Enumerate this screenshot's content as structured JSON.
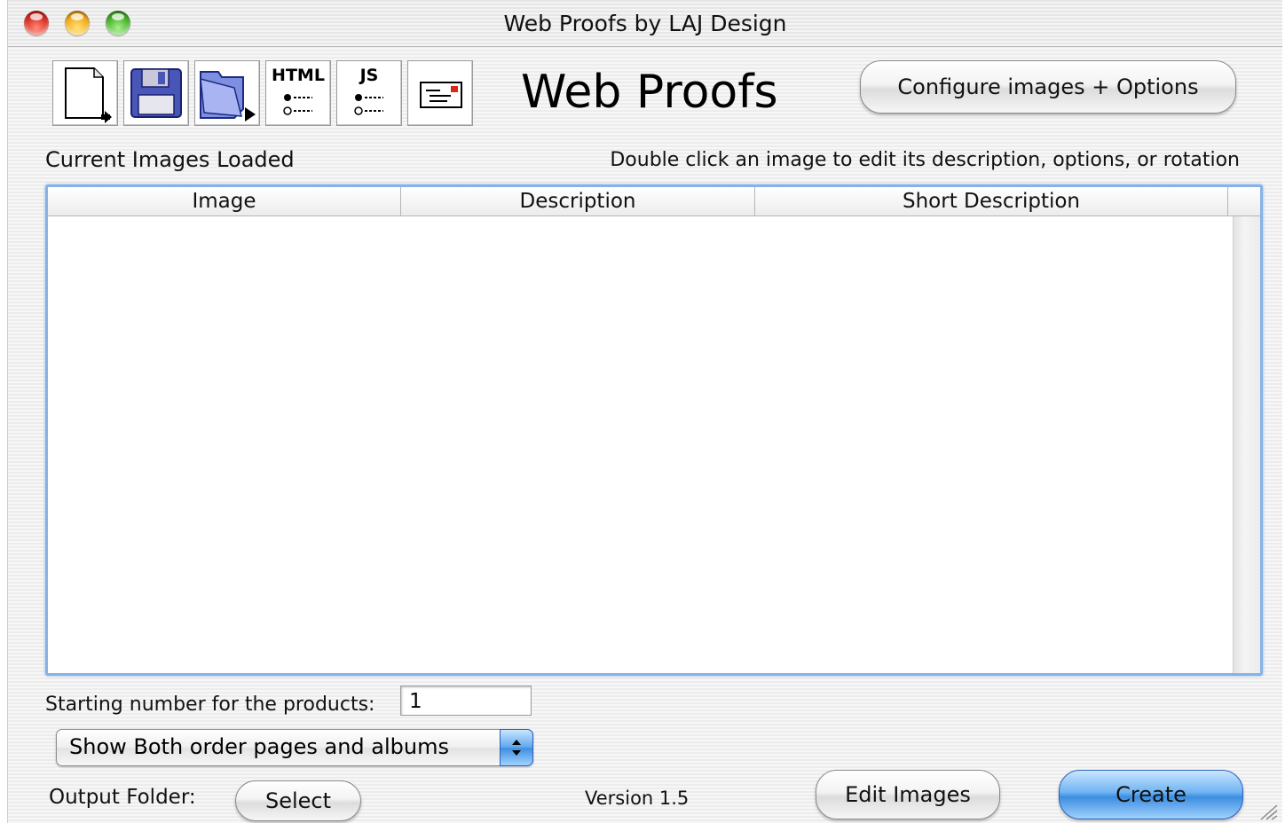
{
  "window": {
    "title": "Web Proofs by LAJ Design"
  },
  "toolbar": {
    "tools": [
      {
        "icon": "new-document-icon"
      },
      {
        "icon": "save-disk-icon"
      },
      {
        "icon": "open-folder-icon"
      },
      {
        "icon": "html-list-icon",
        "label": "HTML"
      },
      {
        "icon": "js-list-icon",
        "label": "JS"
      },
      {
        "icon": "card-envelope-icon"
      }
    ]
  },
  "header": {
    "app_title": "Web Proofs",
    "configure_label": "Configure images + Options"
  },
  "images_panel": {
    "title": "Current Images Loaded",
    "hint": "Double click an image to edit its description, options, or rotation",
    "columns": [
      "Image",
      "Description",
      "Short Description"
    ],
    "rows": []
  },
  "options": {
    "starting_number_label": "Starting number for the products:",
    "starting_number_value": "1",
    "mode_select_value": "Show Both order pages and albums",
    "output_folder_label": "Output Folder:",
    "select_label": "Select",
    "version": "Version 1.5",
    "edit_images_label": "Edit Images",
    "create_label": "Create"
  },
  "colors": {
    "accent_blue": "#3d8de0",
    "table_focus_border": "#86b2e6"
  }
}
